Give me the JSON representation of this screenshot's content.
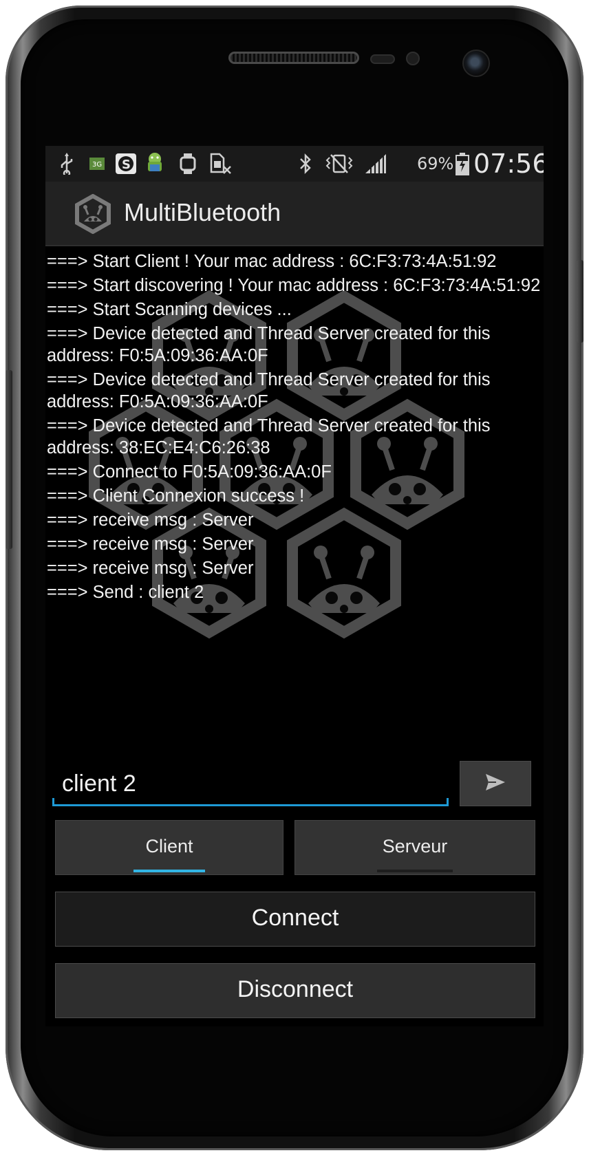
{
  "status_bar": {
    "icons": [
      "usb-icon",
      "3g-icon",
      "skype-icon",
      "android-icon",
      "watch-icon",
      "no-sim-icon",
      "bluetooth-icon",
      "vibrate-icon",
      "signal-icon",
      "battery-icon"
    ],
    "battery_percent": "69%",
    "time": "07:56"
  },
  "action_bar": {
    "title": "MultiBluetooth"
  },
  "log": {
    "lines": [
      "===> Start Client ! Your mac address : 6C:F3:73:4A:51:92",
      "===> Start discovering ! Your mac address : 6C:F3:73:4A:51:92",
      "===> Start Scanning devices ...",
      "===> Device detected and Thread Server created for this address: F0:5A:09:36:AA:0F",
      "===> Device detected and Thread Server created for this address: F0:5A:09:36:AA:0F",
      "===> Device detected and Thread Server created for this address: 38:EC:E4:C6:26:38",
      "===> Connect to F0:5A:09:36:AA:0F",
      "===> Client Connexion success !",
      "===> receive msg : Server",
      "===> receive msg : Server",
      "===> receive msg : Server",
      "===> Send : client 2"
    ]
  },
  "message_input": {
    "value": "client 2"
  },
  "tabs": [
    {
      "label": "Client",
      "selected": true
    },
    {
      "label": "Serveur",
      "selected": false
    }
  ],
  "buttons": {
    "connect": "Connect",
    "disconnect": "Disconnect"
  },
  "colors": {
    "accent": "#33b5e5",
    "input_underline": "#1e9ad6",
    "background": "#000000"
  }
}
